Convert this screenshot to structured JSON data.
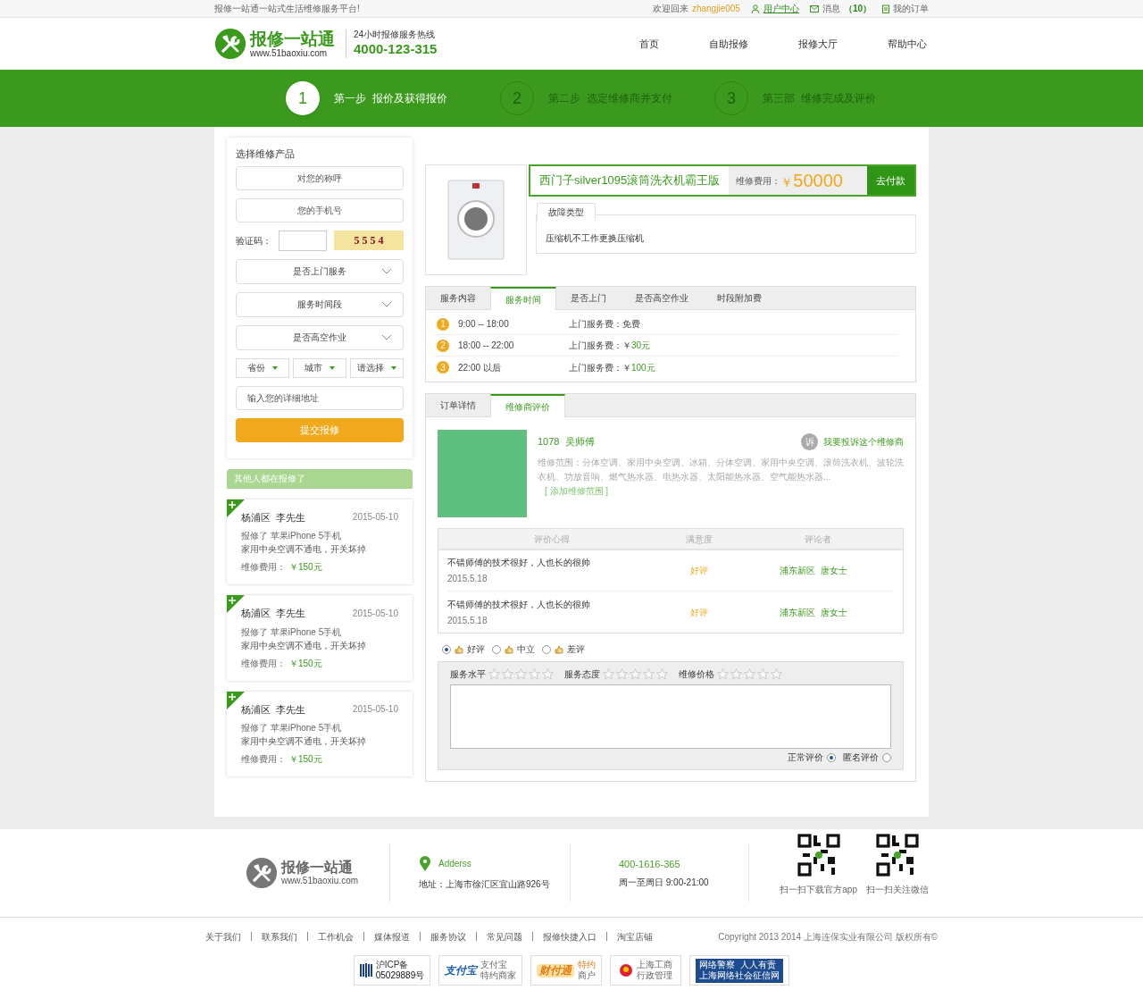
{
  "top_bar": {
    "slogan": "报修一站通一站式生活维修服务平台!",
    "welcome": "欢迎回来",
    "username": "zhangjie005",
    "links": [
      {
        "kind": "user",
        "label": "用户中心"
      },
      {
        "kind": "mail",
        "label": "消息",
        "count": "（10）"
      },
      {
        "kind": "order",
        "label": "我的订单"
      }
    ]
  },
  "header": {
    "logo_name": "报修一站通",
    "logo_url": "www.51baoxiu.com",
    "hotline_label": "24小时报修服务热线",
    "hotline": "4000-123-315",
    "nav": [
      "首页",
      "自助报修",
      "报修大厅",
      "帮助中心"
    ]
  },
  "steps": [
    {
      "number": "1",
      "label": "第一步  报价及获得报价",
      "selected": true
    },
    {
      "number": "2",
      "label": "第二步  选定维修商并支付",
      "selected": false
    },
    {
      "number": "3",
      "label": "第三部  维修完成及评价",
      "selected": false
    }
  ],
  "form": {
    "title": "选择维修产品",
    "name_placeholder": "对您的称呼",
    "phone_placeholder": "您的手机号",
    "captcha_label": "验证码：",
    "captcha": "5 5 5 4",
    "selects": [
      "是否上门服务",
      "服务时间段",
      "是否高空作业"
    ],
    "region_selects": [
      "省份",
      "城市",
      "请选择"
    ],
    "address_placeholder": "输入您的详细地址",
    "submit": "提交报修"
  },
  "recent": {
    "title": "其他人都在报修了",
    "cards": [
      {
        "who": "杨浦区  李先生",
        "date": "2015-05-10",
        "line1": "报修了 苹果iPhone 5手机",
        "line2": "家用中央空调不通电，开关坏掉",
        "fee_label": "维修费用：",
        "fee": "￥150元"
      },
      {
        "who": "杨浦区  李先生",
        "date": "2015-05-10",
        "line1": "报修了 苹果iPhone 5手机",
        "line2": "家用中央空调不通电，开关坏掉",
        "fee_label": "维修费用：",
        "fee": "￥150元"
      },
      {
        "who": "杨浦区  李先生",
        "date": "2015-05-10",
        "line1": "报修了 苹果iPhone 5手机",
        "line2": "家用中央空调不通电，开关坏掉",
        "fee_label": "维修费用：",
        "fee": "￥150元"
      }
    ]
  },
  "product": {
    "title": "西门子silver1095滚筒洗衣机霸王版",
    "fee_label": "维修费用：",
    "currency": "￥",
    "fee": "50000",
    "pay": "去付款",
    "fault_tab": "故障类型",
    "fault": "压缩机不工作更换压缩机"
  },
  "service_tabs": [
    {
      "label": "服务内容",
      "selected": false
    },
    {
      "label": "服务时间",
      "selected": true
    },
    {
      "label": "是否上门",
      "selected": false
    },
    {
      "label": "是否高空作业",
      "selected": false
    },
    {
      "label": "时段附加费",
      "selected": false
    }
  ],
  "service_rows": [
    {
      "number": "1",
      "time": "9:00 -- 18:00",
      "fee_label": "上门服务费：",
      "fee": "免费"
    },
    {
      "number": "2",
      "time": "18:00 -- 22:00",
      "fee_label": "上门服务费：￥",
      "fee": "30元"
    },
    {
      "number": "3",
      "time": "22:00 以后",
      "fee_label": "上门服务费：￥",
      "fee": "100元"
    }
  ],
  "review_tabs": [
    {
      "label": "订单详情",
      "selected": false
    },
    {
      "label": "维修商评价",
      "selected": true
    }
  ],
  "repairer": {
    "name": "1078  吴师傅",
    "complain_badge": "诉",
    "complain": "我要投诉这个维修商",
    "scope": "维修范围：分体空调、家用中央空调、冰箱、分体空调、家用中央空调、滚筒洗衣机、波轮洗衣机、功放音响、燃气热水器、电热水器、太阳能热水器、空气能热水器...",
    "scope_link": "[ 添加维修范围 ]"
  },
  "reviews": {
    "columns": [
      "评价心得",
      "满意度",
      "评论者"
    ],
    "rows": [
      {
        "text": "不错师傅的技术很好，人也长的很帅",
        "date": "2015.5.18",
        "rating": "好评",
        "reviewer": "浦东新区  唐女士"
      },
      {
        "text": "不错师傅的技术很好，人也长的很帅",
        "date": "2015.5.18",
        "rating": "好评",
        "reviewer": "浦东新区  唐女士"
      }
    ]
  },
  "review_form": {
    "choices": [
      {
        "label": "好评",
        "selected": true
      },
      {
        "label": "中立",
        "selected": false
      },
      {
        "label": "差评",
        "selected": false
      }
    ],
    "ratings": [
      {
        "label": "服务水平",
        "stars": 0
      },
      {
        "label": "服务态度",
        "stars": 0
      },
      {
        "label": "维修价格",
        "stars": 0
      }
    ],
    "modes": [
      {
        "label": "正常评价",
        "selected": true
      },
      {
        "label": "匿名评价",
        "selected": false
      }
    ]
  },
  "footer": {
    "logo_name": "报修一站通",
    "logo_url": "www.51baoxiu.com",
    "address_title": "Adderss",
    "address": "地址：上海市徐汇区宜山路926号",
    "phone": "400-1616-365",
    "hours": "周一至周日 9:00-21:00",
    "qr_captions": [
      "扫一扫下载官方app",
      "扫一扫关注微信"
    ],
    "links": [
      "关于我们",
      "联系我们",
      "工作机会",
      "媒体报道",
      "服务协议",
      "常见问题",
      "报修快捷入口",
      "淘宝店铺"
    ],
    "copyright": "Copyright 2013 2014 上海连保实业有限公司 版权所有©",
    "badges": [
      {
        "kind": "icp",
        "line1": "沪ICP备",
        "line2": "05029889号"
      },
      {
        "kind": "alipay",
        "logo": "支付宝",
        "line1": "支付宝",
        "line2": "特约商家"
      },
      {
        "kind": "tenpay",
        "logo": "财付通",
        "line1": "特约",
        "line2": "商户"
      },
      {
        "kind": "gov",
        "line1": "上海工商",
        "line2": "行政管理"
      },
      {
        "kind": "police",
        "line1": "网络警察  人人有责",
        "line2": "上海网络社会征信网"
      }
    ]
  }
}
